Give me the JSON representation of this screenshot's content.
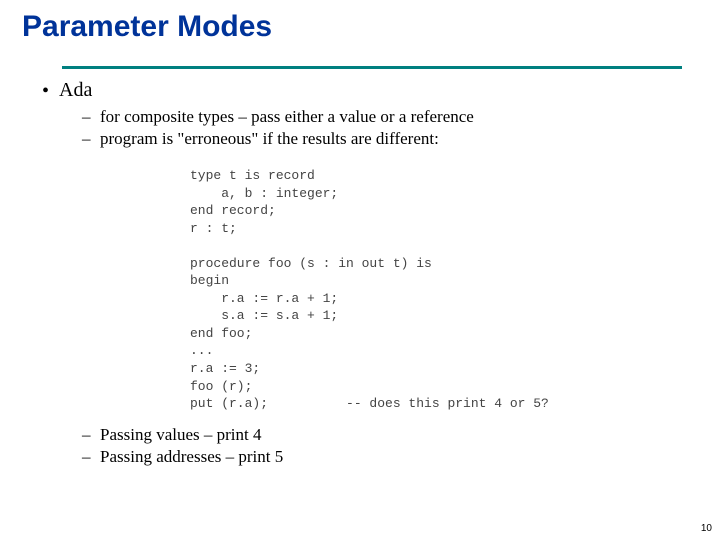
{
  "title": "Parameter Modes",
  "bullet1": "Ada",
  "sub1": "for composite types – pass either a value or a reference",
  "sub2": "program is \"erroneous\" if the results are different:",
  "code": "type t is record\n    a, b : integer;\nend record;\nr : t;\n\nprocedure foo (s : in out t) is\nbegin\n    r.a := r.a + 1;\n    s.a := s.a + 1;\nend foo;\n...\nr.a := 3;\nfoo (r);\nput (r.a);          -- does this print 4 or 5?",
  "sub3": "Passing values –      print 4",
  "sub4": "Passing addresses –        print 5",
  "page": "10"
}
